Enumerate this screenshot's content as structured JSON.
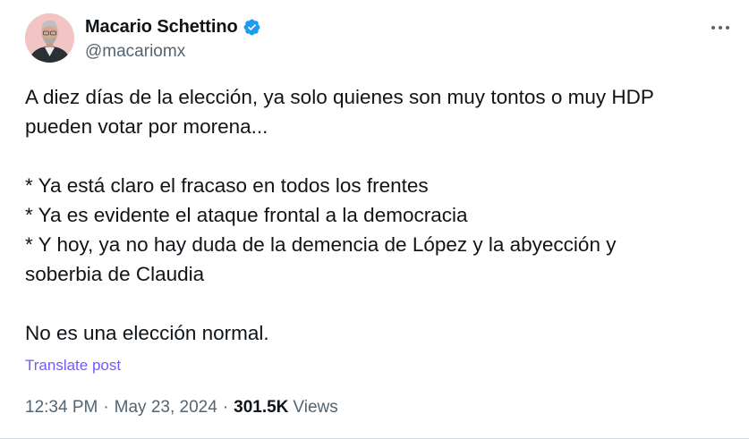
{
  "author": {
    "display_name": "Macario Schettino",
    "handle": "@macariomx",
    "verified": true
  },
  "icons": {
    "verified": "verified-badge-icon",
    "more": "more-options-icon"
  },
  "tweet": {
    "lines": [
      "A diez días de la elección, ya solo quienes son muy tontos o muy HDP",
      "pueden votar por morena...",
      "",
      "* Ya está claro el fracaso en todos los frentes",
      "* Ya es evidente el ataque frontal a la democracia",
      "* Y hoy, ya no hay duda de la demencia de López y la abyección y",
      "soberbia de Claudia",
      "",
      "No es una elección normal."
    ]
  },
  "translate_label": "Translate post",
  "meta": {
    "time": "12:34 PM",
    "separator": "·",
    "date": "May 23, 2024",
    "views_count": "301.5K",
    "views_label": "Views"
  },
  "colors": {
    "text": "#0f1419",
    "secondary": "#536471",
    "link": "#7856ff",
    "verified": "#1d9bf0"
  }
}
